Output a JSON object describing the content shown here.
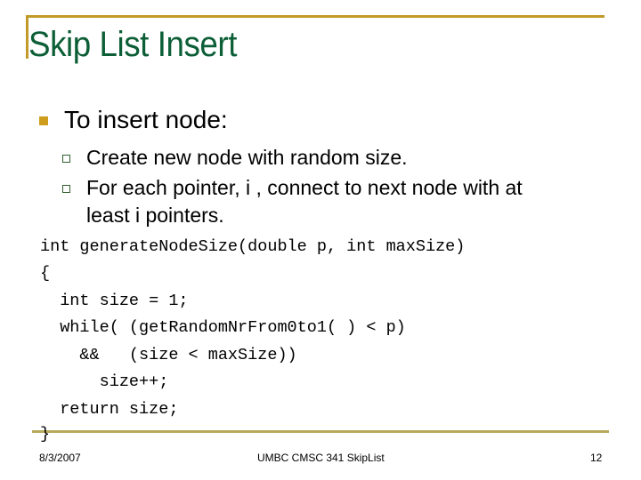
{
  "slide": {
    "title": "Skip List Insert",
    "bullets": [
      {
        "text": "To insert node:",
        "sub_bullets": [
          {
            "lines": [
              "Create new node with random size."
            ]
          },
          {
            "lines": [
              "For each pointer, i , connect to next node with at",
              "least i pointers."
            ]
          }
        ]
      }
    ],
    "code_lines": [
      "int generateNodeSize(double p, int maxSize)",
      "{",
      "  int size = 1;",
      "  while( (getRandomNrFrom0to1( ) < p)",
      "    &&   (size < maxSize))",
      "      size++;",
      "  return size;",
      "}"
    ],
    "footer": {
      "date": "8/3/2007",
      "course": "UMBC CMSC 341 SkipList",
      "page_number": "12"
    }
  },
  "colors": {
    "title": "#0c5e36",
    "accent_rule": "#c29a2a",
    "bullet": "#cf9d1d",
    "sub_bullet_border": "#2f5e2e",
    "footer_rule": "#b7a95a"
  }
}
